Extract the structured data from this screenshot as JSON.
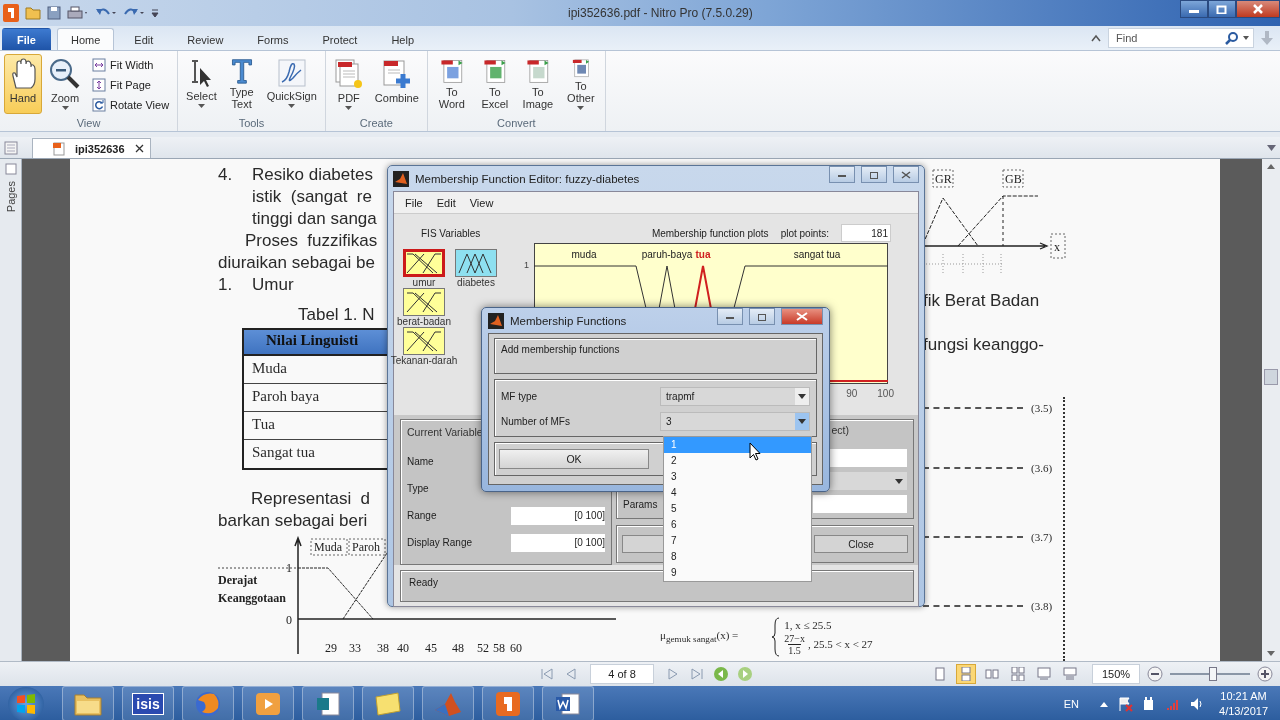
{
  "app": {
    "title": "ipi352636.pdf - Nitro Pro (7.5.0.29)"
  },
  "file_menu": {
    "label": "File"
  },
  "ribbon_tabs": [
    {
      "label": "Home",
      "selected": true
    },
    {
      "label": "Edit",
      "selected": false
    },
    {
      "label": "Review",
      "selected": false
    },
    {
      "label": "Forms",
      "selected": false
    },
    {
      "label": "Protect",
      "selected": false
    },
    {
      "label": "Help",
      "selected": false
    }
  ],
  "find": {
    "placeholder": "Find"
  },
  "ribbon_groups": [
    {
      "title": "View",
      "tools": [
        {
          "label": "Hand",
          "kind": "large",
          "selected": true,
          "menu": false
        },
        {
          "label": "Zoom",
          "kind": "large",
          "selected": false,
          "menu": true
        },
        {
          "label": "Fit Width",
          "kind": "small",
          "selected": false,
          "menu": false
        },
        {
          "label": "Fit Page",
          "kind": "small",
          "selected": false,
          "menu": false
        },
        {
          "label": "Rotate View",
          "kind": "small",
          "selected": false,
          "menu": false
        }
      ]
    },
    {
      "title": "Tools",
      "tools": [
        {
          "label": "Select",
          "kind": "large",
          "selected": false,
          "menu": true
        },
        {
          "label": "Type Text",
          "kind": "large",
          "selected": false,
          "menu": false
        },
        {
          "label": "QuickSign",
          "kind": "large",
          "selected": false,
          "menu": true
        }
      ]
    },
    {
      "title": "Create",
      "tools": [
        {
          "label": "PDF",
          "kind": "large",
          "selected": false,
          "menu": true
        },
        {
          "label": "Combine",
          "kind": "large",
          "selected": false,
          "menu": false
        }
      ]
    },
    {
      "title": "Convert",
      "tools": [
        {
          "label": "To Word",
          "kind": "large",
          "selected": false,
          "menu": false
        },
        {
          "label": "To Excel",
          "kind": "large",
          "selected": false,
          "menu": false
        },
        {
          "label": "To Image",
          "kind": "large",
          "selected": false,
          "menu": false
        },
        {
          "label": "To Other",
          "kind": "large",
          "selected": false,
          "menu": true
        }
      ]
    }
  ],
  "document_tab": {
    "label": "ipi352636",
    "selected": true
  },
  "side_panel": {
    "label": "Pages"
  },
  "page": {
    "list_item": {
      "number": "4.",
      "lines": [
        "Resiko diabetes",
        "istik  (sangat  re",
        "tinggi dan sanga"
      ]
    },
    "paragraph_lines": [
      "Proses  fuzzifikas",
      "diuraikan sebagai be"
    ],
    "heading": {
      "number": "1.",
      "text": "Umur"
    },
    "table_caption": "Tabel 1. N",
    "table": {
      "header": "Nilai Linguisti",
      "rows": [
        "Muda",
        "Paroh baya",
        "Tua",
        "Sangat tua"
      ]
    },
    "representation_lines": [
      "Representasi  d",
      "barkan sebagai beri"
    ],
    "chart_left": {
      "ylabel_lines": [
        "Derajat",
        "Keanggotaan"
      ],
      "labels": [
        "Muda",
        "Paroh"
      ],
      "yticks": [
        "1",
        "0"
      ],
      "xticks": [
        "29",
        "33",
        "38",
        "40",
        "45",
        "48",
        "52",
        "58",
        "60"
      ]
    },
    "chart_right": {
      "labels": [
        "GR",
        "GB"
      ],
      "axis_label": "x"
    },
    "right_lines": [
      "fik Berat Badan",
      "fungsi keanggo-"
    ],
    "equation_numbers": [
      "(3.5)",
      "(3.6)",
      "(3.7)",
      "(3.8)"
    ],
    "formula": {
      "lhs": "μ$_{gemuk sangat}$(x) =",
      "case_1": "1, x ≤ 25.5",
      "numerator": "27−x",
      "denominator": "1.5",
      "case_2": ", 25.5 < x < 27"
    }
  },
  "mf_editor": {
    "title": "Membership Function Editor: fuzzy-diabetes",
    "menu": [
      "File",
      "Edit",
      "View"
    ],
    "fis_label": "FIS Variables",
    "variables": [
      {
        "name": "umur",
        "kind": "input",
        "selected": true
      },
      {
        "name": "diabetes",
        "kind": "output",
        "selected": false
      },
      {
        "name": "berat-badan",
        "kind": "input",
        "selected": false
      },
      {
        "name": "Tekanan-darah",
        "kind": "input",
        "selected": false
      }
    ],
    "plot": {
      "title": "Membership function plots",
      "points_label": "plot points:",
      "points": "181",
      "ytick": "1",
      "xticks": [
        "90",
        "100"
      ],
      "mfs": [
        {
          "name": "muda",
          "selected": false
        },
        {
          "name": "paruh-baya",
          "selected": false
        },
        {
          "name": "tua",
          "selected": true
        },
        {
          "name": "sangat tua",
          "selected": false
        }
      ]
    },
    "current_variable": {
      "title": "Current Variable",
      "fields": [
        {
          "label": "Name"
        },
        {
          "label": "Type"
        },
        {
          "label": "Range",
          "value": "[0 100]"
        },
        {
          "label": "Display Range",
          "value": "[0 100]"
        }
      ]
    },
    "current_mf": {
      "title": "ect)",
      "params_label": "Params",
      "close": "Close"
    },
    "status": "Ready"
  },
  "mf_dialog": {
    "title": "Membership Functions",
    "heading": "Add membership functions",
    "mf_type": {
      "label": "MF type",
      "value": "trapmf"
    },
    "count": {
      "label": "Number of MFs",
      "value": "3",
      "expanded": true
    },
    "ok": "OK",
    "options": [
      {
        "label": "1",
        "selected": true
      },
      {
        "label": "2",
        "selected": false
      },
      {
        "label": "3",
        "selected": false
      },
      {
        "label": "4",
        "selected": false
      },
      {
        "label": "5",
        "selected": false
      },
      {
        "label": "6",
        "selected": false
      },
      {
        "label": "7",
        "selected": false
      },
      {
        "label": "8",
        "selected": false
      },
      {
        "label": "9",
        "selected": false
      }
    ]
  },
  "navigation": {
    "page": "4 of 8",
    "zoom": "150%",
    "zoom_slider": {
      "level": 0.54
    },
    "view_modes": [
      {
        "kind": "single",
        "selected": false
      },
      {
        "kind": "continuous",
        "selected": true
      },
      {
        "kind": "facing",
        "selected": false
      },
      {
        "kind": "continuous-facing",
        "selected": false
      },
      {
        "kind": "cover",
        "selected": false
      },
      {
        "kind": "cover-continuous",
        "selected": false
      }
    ]
  },
  "taskbar": {
    "apps": [
      {
        "kind": "folder"
      },
      {
        "kind": "isis",
        "label": "isis"
      },
      {
        "kind": "browser"
      },
      {
        "kind": "media"
      },
      {
        "kind": "publisher"
      },
      {
        "kind": "notes"
      },
      {
        "kind": "matlab"
      },
      {
        "kind": "nitro"
      },
      {
        "kind": "word"
      }
    ],
    "language": "EN",
    "time": "10:21 AM",
    "date": "4/13/2017"
  }
}
